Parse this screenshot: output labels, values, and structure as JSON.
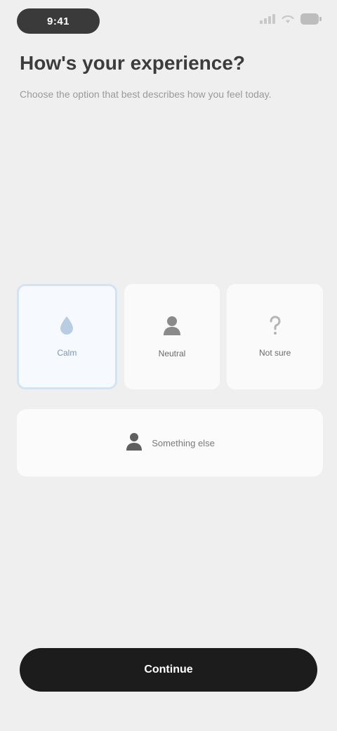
{
  "status_bar": {
    "time": "9:41",
    "icons": [
      "signal-icon",
      "wifi-icon",
      "battery-icon"
    ]
  },
  "header": {
    "title": "How's your experience?",
    "subtitle": "Choose the option that best describes how you feel today."
  },
  "options": [
    {
      "label": "Calm",
      "icon": "drop-icon",
      "selected": true
    },
    {
      "label": "Neutral",
      "icon": "person-icon",
      "selected": false
    },
    {
      "label": "Not sure",
      "icon": "question-icon",
      "selected": false
    }
  ],
  "wide_option": {
    "label": "Something else",
    "icon": "person-icon"
  },
  "footer": {
    "continue_label": "Continue"
  },
  "colors": {
    "accent_selected_border": "#d3e3f2",
    "button_background": "#1c1c1c",
    "page_background": "#efefef"
  }
}
